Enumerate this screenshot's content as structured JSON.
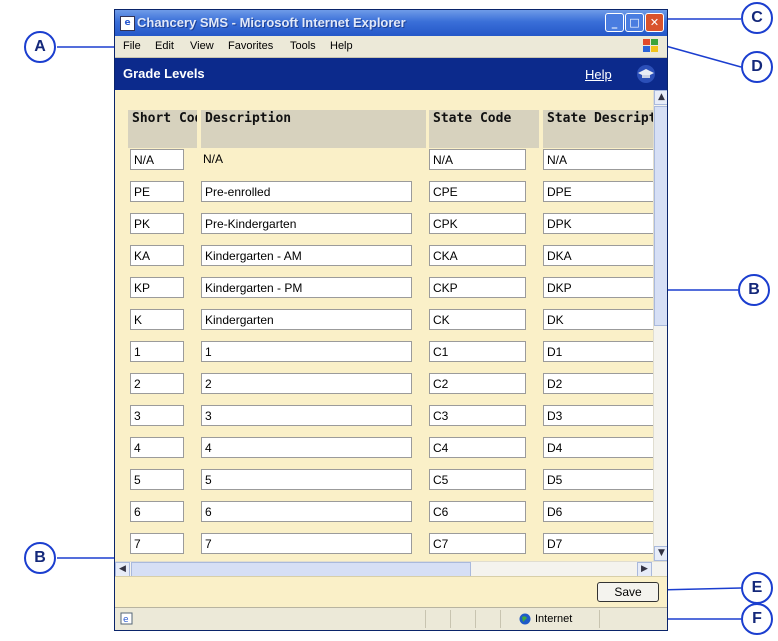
{
  "window": {
    "title": "Chancery SMS - Microsoft Internet Explorer"
  },
  "menu": [
    "File",
    "Edit",
    "View",
    "Favorites",
    "Tools",
    "Help"
  ],
  "app": {
    "title": "Grade Levels",
    "help_label": "Help"
  },
  "table": {
    "headers": [
      "Short Code",
      "Description",
      "State Code",
      "State Descripti"
    ],
    "rows": [
      [
        "N/A",
        "N/A",
        "N/A",
        "N/A"
      ],
      [
        "PE",
        "Pre-enrolled",
        "CPE",
        "DPE"
      ],
      [
        "PK",
        "Pre-Kindergarten",
        "CPK",
        "DPK"
      ],
      [
        "KA",
        "Kindergarten - AM",
        "CKA",
        "DKA"
      ],
      [
        "KP",
        "Kindergarten - PM",
        "CKP",
        "DKP"
      ],
      [
        "K",
        "Kindergarten",
        "CK",
        "DK"
      ],
      [
        "1",
        "1",
        "C1",
        "D1"
      ],
      [
        "2",
        "2",
        "C2",
        "D2"
      ],
      [
        "3",
        "3",
        "C3",
        "D3"
      ],
      [
        "4",
        "4",
        "C4",
        "D4"
      ],
      [
        "5",
        "5",
        "C5",
        "D5"
      ],
      [
        "6",
        "6",
        "C6",
        "D6"
      ],
      [
        "7",
        "7",
        "C7",
        "D7"
      ]
    ]
  },
  "footer": {
    "save_label": "Save"
  },
  "status": {
    "zone": "Internet"
  },
  "callouts": {
    "a": "A",
    "b": "B",
    "c": "C",
    "d": "D",
    "e": "E",
    "f": "F"
  },
  "colors": {
    "app_bar": "#0c2a8c",
    "content_bg": "#faf0c8",
    "header_bg": "#d7d2be",
    "callout": "#1b3ecf"
  }
}
